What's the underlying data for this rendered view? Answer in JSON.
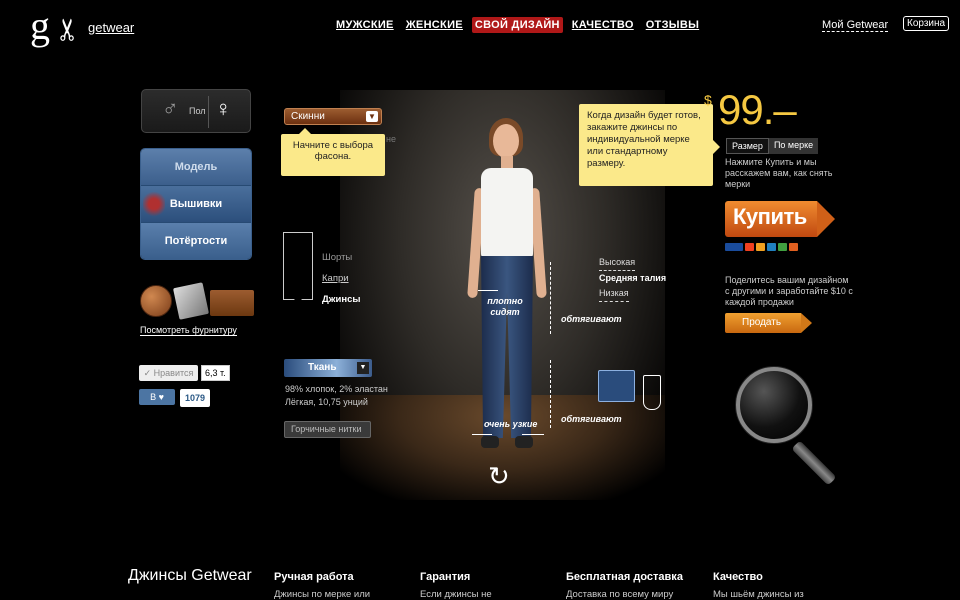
{
  "header": {
    "logo_letter": "g",
    "brand": "getwear",
    "nav": [
      "МУЖСКИЕ",
      "ЖЕНСКИЕ",
      "СВОЙ ДИЗАЙН",
      "КАЧЕСТВО",
      "ОТЗЫВЫ"
    ],
    "nav_active_index": 2,
    "my_account": "Мой Getwear",
    "cart": "Корзина"
  },
  "sidebar": {
    "gender_label": "Пол",
    "menu": [
      "Модель",
      "Вышивки",
      "Потёртости"
    ],
    "fittings_link": "Посмотреть фурнитуру",
    "like_label": "✓ Нравится",
    "like_count": "6,3 т.",
    "vk_label": "В ♥",
    "vk_count": "1079"
  },
  "designer": {
    "style_select": "Скинни",
    "style_tooltip": "Начните с выбора фасона.",
    "faint_text": "не",
    "pants_types": [
      "Шорты",
      "Капри",
      "Джинсы"
    ],
    "active_pant": "Джинсы",
    "fabric_select": "Ткань",
    "fabric_composition": "98% хлопок, 2% эластан",
    "fabric_weight": "Лёгкая, 10,75 унций",
    "thread_button": "Горчичные нитки",
    "waist_options": [
      "Высокая",
      "Средняя талия",
      "Низкая"
    ],
    "annotations": {
      "fit_tight": "плотно сидят",
      "hug_1": "обтягивают",
      "hug_2": "обтягивают",
      "very_narrow": "очень узкие"
    },
    "order_tooltip": "Когда дизайн будет готов, закажите джинсы по индивидуальной мерке или стандартному размеру."
  },
  "purchase": {
    "currency": "$",
    "price": "99.–",
    "size_tabs": [
      "Размер",
      "По мерке"
    ],
    "buy_hint": "Нажмите Купить и мы расскажем вам, как снять мерки",
    "buy_button": "Купить",
    "share_hint": "Поделитесь вашим дизайном с другими и заработайте $10 с каждой продажи",
    "sell_button": "Продать",
    "card_colors": [
      "#1a4c9c",
      "#f04020",
      "#f0a020",
      "#2080c0",
      "#40a040",
      "#e06020"
    ]
  },
  "footer": {
    "title": "Джинсы Getwear",
    "columns": [
      {
        "heading": "Ручная работа",
        "text": "Джинсы по мерке или"
      },
      {
        "heading": "Гарантия",
        "text": "Если джинсы не"
      },
      {
        "heading": "Бесплатная доставка",
        "text": "Доставка по всему миру"
      },
      {
        "heading": "Качество",
        "text": "Мы шьём джинсы из"
      }
    ]
  }
}
